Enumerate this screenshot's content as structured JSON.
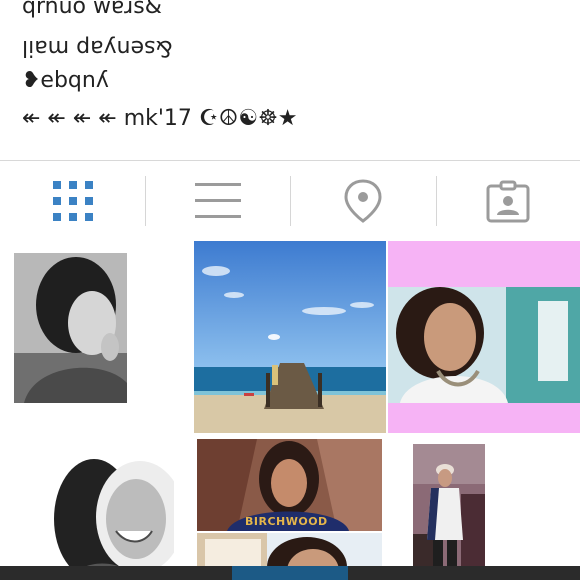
{
  "profile": {
    "bio_lines": [
      {
        "text": "qrnuo wɐɹs&",
        "flipped": false
      },
      {
        "text": "&senyap mail",
        "flipped": true
      },
      {
        "text": "❥ebqnʎ",
        "flipped": false
      },
      {
        "text": "↞ ↞ ↞ ↞ mk'17 ☪☮☯☸★",
        "flipped": false
      }
    ]
  },
  "tabs": [
    {
      "name": "grid-view",
      "icon": "grid-icon",
      "active": true
    },
    {
      "name": "list-view",
      "icon": "list-icon",
      "active": false
    },
    {
      "name": "location-view",
      "icon": "map-pin-icon",
      "active": false
    },
    {
      "name": "tagged-view",
      "icon": "tagged-person-icon",
      "active": false
    }
  ],
  "colors": {
    "active_tab": "#3b82c4",
    "inactive_tab": "#9b9b9b",
    "pink_border": "#f6b3f5",
    "bottom_bar": "#2b2b2b",
    "bottom_accent": "#1c5a86"
  },
  "photos": [
    {
      "name": "bw-portrait-photo",
      "subject": "black and white selfie"
    },
    {
      "name": "beach-pier-photo",
      "subject": "pier on beach with blue sky"
    },
    {
      "name": "selfie-pink-border-photo",
      "subject": "curly hair selfie with pink border"
    },
    {
      "name": "smiling-bw-photo",
      "subject": "black and white smiling portrait"
    },
    {
      "name": "birchwood-shirt-photo",
      "subject": "girl wearing birchwood shirt",
      "caption": "BIRCHWOOD"
    },
    {
      "name": "standing-room-photo",
      "subject": "girl standing in room"
    },
    {
      "name": "partial-selfie-photo",
      "subject": "partial selfie"
    }
  ]
}
